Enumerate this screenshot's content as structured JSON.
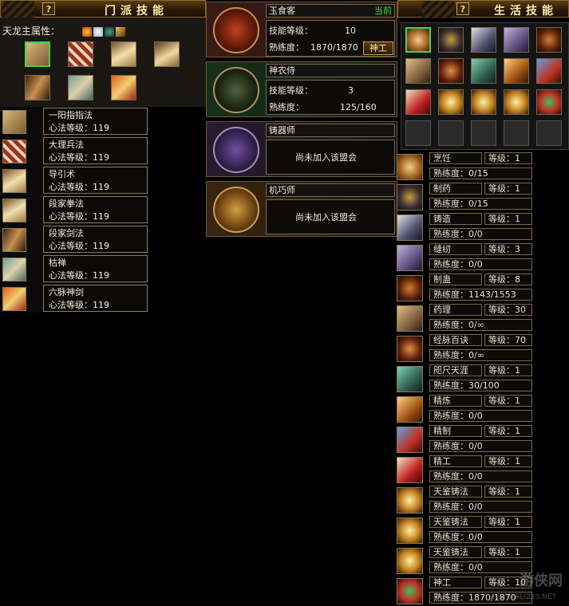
{
  "sect_panel": {
    "title": "门派技能",
    "help_label": "?",
    "attribute_label": "天龙主属性：",
    "attr_icons": [
      "fire-icon",
      "ice-icon",
      "mystic-icon",
      "poison-icon"
    ],
    "books": [
      {
        "icon": "scroll-book-icon",
        "selected": true
      },
      {
        "icon": "army-book-icon"
      },
      {
        "icon": "open-book-icon"
      },
      {
        "icon": "open-book-icon"
      },
      {
        "icon": "sword-book-icon"
      },
      {
        "icon": "zen-book-icon"
      },
      {
        "icon": "six-meridian-book-icon"
      }
    ],
    "skills": [
      {
        "name": "一阳指指法",
        "level": "心法等级：119",
        "icon": "scroll-book-icon"
      },
      {
        "name": "大理兵法",
        "level": "心法等级：119",
        "icon": "army-book-icon"
      },
      {
        "name": "导引术",
        "level": "心法等级：119",
        "icon": "open-book-icon"
      },
      {
        "name": "段家拳法",
        "level": "心法等级：119",
        "icon": "open-book-icon"
      },
      {
        "name": "段家剑法",
        "level": "心法等级：119",
        "icon": "sword-book-icon"
      },
      {
        "name": "枯禅",
        "level": "心法等级：119",
        "icon": "zen-book-icon"
      },
      {
        "name": "六脉神剑",
        "level": "心法等级：119",
        "icon": "six-meridian-book-icon"
      }
    ]
  },
  "guilds": [
    {
      "name": "玉食客",
      "badge": "当前",
      "skill_level_label": "技能等级：",
      "skill_level": "10",
      "proficiency_label": "熟练度：",
      "proficiency": "1870/1870",
      "button": "神工",
      "icon": "cook-guild-icon"
    },
    {
      "name": "神农侍",
      "skill_level_label": "技能等级：",
      "skill_level": "3",
      "proficiency_label": "熟练度：",
      "proficiency": "125/160",
      "icon": "herbalist-guild-icon"
    },
    {
      "name": "铸器师",
      "status": "尚未加入该盟会",
      "icon": "smith-guild-icon"
    },
    {
      "name": "机巧师",
      "status": "尚未加入该盟会",
      "icon": "artisan-guild-icon"
    }
  ],
  "life_panel": {
    "title": "生活技能",
    "help_label": "?",
    "grid_icons": [
      "cooking-icon",
      "medicine-pot-icon",
      "forging-icon",
      "sewing-icon",
      "poison-icon",
      "herb-icon",
      "meridian-scorpion-icon",
      "map-icon",
      "refine-icon",
      "craft-icon",
      "scroll-seal-icon",
      "sky-forge-icon",
      "sky-forge-icon",
      "sky-forge-icon",
      "divine-craft-icon"
    ],
    "rows": [
      {
        "name": "烹饪",
        "level": "等级：1",
        "prof": "熟练度：0/15",
        "icon": "cooking-icon"
      },
      {
        "name": "制药",
        "level": "等级：1",
        "prof": "熟练度：0/15",
        "icon": "medicine-pot-icon"
      },
      {
        "name": "铸造",
        "level": "等级：1",
        "prof": "熟练度：0/0",
        "icon": "forging-icon"
      },
      {
        "name": "缝纫",
        "level": "等级：3",
        "prof": "熟练度：0/0",
        "icon": "sewing-icon"
      },
      {
        "name": "制蛊",
        "level": "等级：8",
        "prof": "熟练度：1143/1553",
        "icon": "poison-icon"
      },
      {
        "name": "药理",
        "level": "等级：30",
        "prof": "熟练度：0/∞",
        "icon": "herb-icon"
      },
      {
        "name": "经脉百诀",
        "level": "等级：70",
        "prof": "熟练度：0/∞",
        "icon": "meridian-scorpion-icon"
      },
      {
        "name": "咫尺天涯",
        "level": "等级：1",
        "prof": "熟练度：30/100",
        "icon": "map-icon"
      },
      {
        "name": "精炼",
        "level": "等级：1",
        "prof": "熟练度：0/0",
        "icon": "refine-icon"
      },
      {
        "name": "精制",
        "level": "等级：1",
        "prof": "熟练度：0/0",
        "icon": "craft-icon"
      },
      {
        "name": "精工",
        "level": "等级：1",
        "prof": "熟练度：0/0",
        "icon": "scroll-seal-icon"
      },
      {
        "name": "天鉴铸法",
        "level": "等级：1",
        "prof": "熟练度：0/0",
        "icon": "sky-forge-icon"
      },
      {
        "name": "天鉴铸法",
        "level": "等级：1",
        "prof": "熟练度：0/0",
        "icon": "sky-forge-icon"
      },
      {
        "name": "天鉴铸法",
        "level": "等级：1",
        "prof": "熟练度：0/0",
        "icon": "sky-forge-icon"
      },
      {
        "name": "神工",
        "level": "等级：10",
        "prof": "熟练度：1870/1870",
        "icon": "divine-craft-icon"
      }
    ]
  },
  "watermark": {
    "text": "游侠网",
    "sub": "WWW.ALI213.NET"
  }
}
